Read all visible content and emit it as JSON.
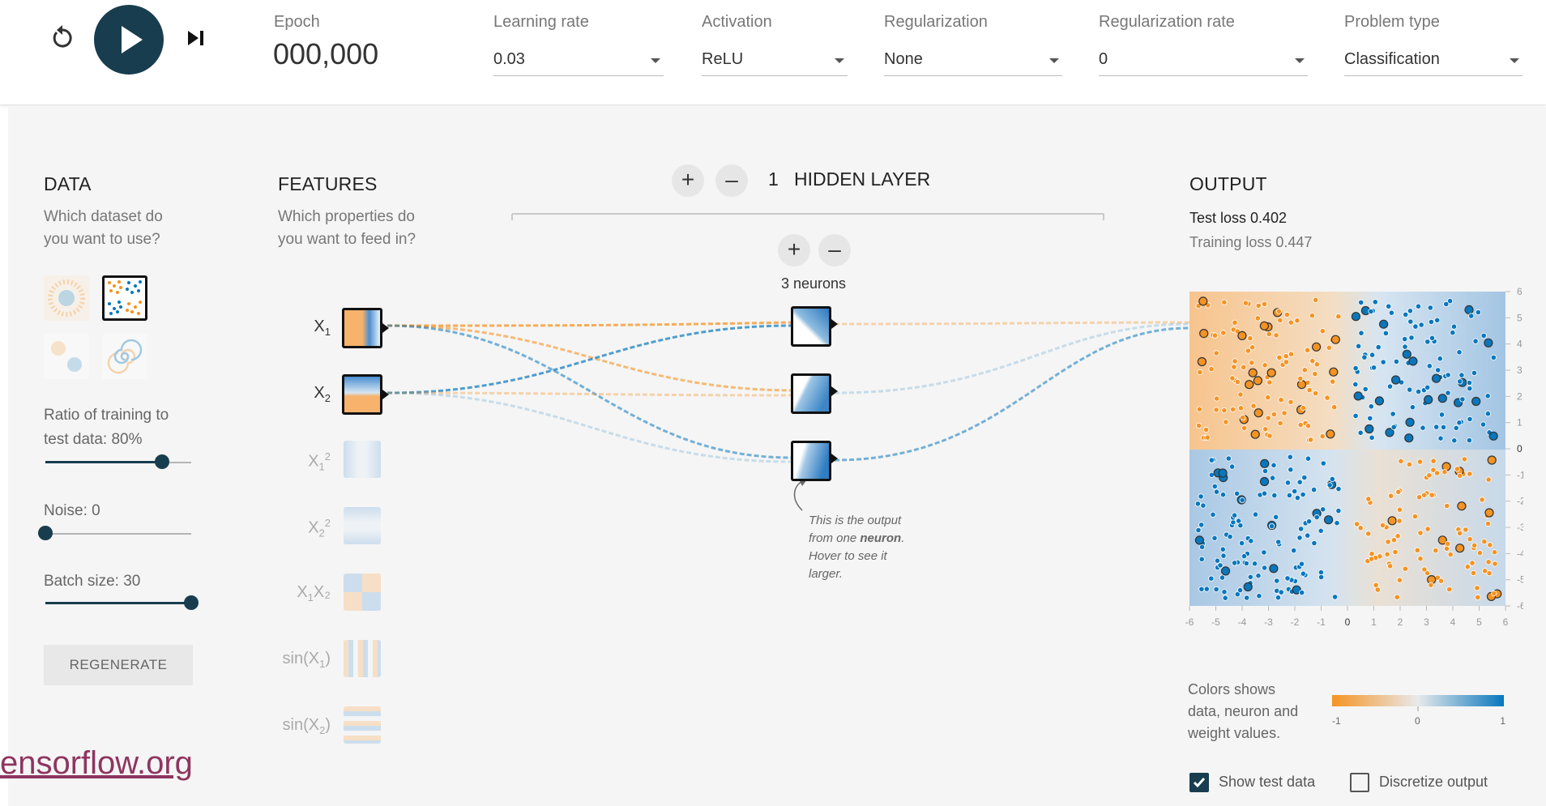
{
  "toolbar": {
    "epoch_label": "Epoch",
    "epoch_value": "000,000",
    "learning_rate_label": "Learning rate",
    "learning_rate_value": "0.03",
    "activation_label": "Activation",
    "activation_value": "ReLU",
    "regularization_label": "Regularization",
    "regularization_value": "None",
    "regularization_rate_label": "Regularization rate",
    "regularization_rate_value": "0",
    "problem_type_label": "Problem type",
    "problem_type_value": "Classification",
    "icons": [
      "reset-icon",
      "play-icon",
      "step-icon",
      "chevron-down-icon"
    ]
  },
  "data": {
    "title": "DATA",
    "subtitle_line1": "Which dataset do",
    "subtitle_line2": "you want to use?",
    "datasets": [
      "circle",
      "xor",
      "gaussian",
      "spiral"
    ],
    "selected_dataset": "xor",
    "ratio_label_line1": "Ratio of training to",
    "ratio_label_line2": "test data:  80%",
    "ratio_value": 0.8,
    "noise_label": "Noise:  0",
    "noise_value": 0,
    "batch_label": "Batch size:  30",
    "batch_value": 1.0,
    "regenerate_label": "REGENERATE"
  },
  "features": {
    "title": "FEATURES",
    "subtitle_line1": "Which properties do",
    "subtitle_line2": "you want to feed in?",
    "items": [
      {
        "base": "X",
        "sub": "1",
        "sup": "",
        "rest": "",
        "active": true
      },
      {
        "base": "X",
        "sub": "2",
        "sup": "",
        "rest": "",
        "active": true
      },
      {
        "base": "X",
        "sub": "1",
        "sup": "2",
        "rest": "",
        "active": false
      },
      {
        "base": "X",
        "sub": "2",
        "sup": "2",
        "rest": "",
        "active": false
      },
      {
        "base": "X",
        "sub": "1",
        "sup": "",
        "rest": "X₂",
        "active": false
      },
      {
        "base": "sin(X",
        "sub": "1",
        "sup": "",
        "rest": ")",
        "active": false
      },
      {
        "base": "sin(X",
        "sub": "2",
        "sup": "",
        "rest": ")",
        "active": false
      }
    ]
  },
  "network": {
    "layer_count": "1",
    "hidden_layer_label": "HIDDEN LAYER",
    "neuron_count_label": "3 neurons",
    "add_icon": "+",
    "remove_icon": "–",
    "callout_line1": "This is the output",
    "callout_line2_pre": "from one ",
    "callout_line2_bold": "neuron",
    "callout_line2_post": ".",
    "callout_line3": "Hover to see it",
    "callout_line4": "larger."
  },
  "output": {
    "title": "OUTPUT",
    "test_loss": "Test loss 0.402",
    "training_loss": "Training loss 0.447",
    "x_ticks": [
      "-6",
      "-5",
      "-4",
      "-3",
      "-2",
      "-1",
      "0",
      "1",
      "2",
      "3",
      "4",
      "5",
      "6"
    ],
    "y_ticks": [
      "6",
      "5",
      "4",
      "3",
      "2",
      "1",
      "0",
      "-1",
      "-2",
      "-3",
      "-4",
      "-5",
      "-6"
    ],
    "legend_line1": "Colors shows",
    "legend_line2": "data, neuron and",
    "legend_line3": "weight values.",
    "legend_ticks": [
      "-1",
      "0",
      "1"
    ],
    "show_test_label": "Show test data",
    "show_test_checked": true,
    "discretize_label": "Discretize output",
    "discretize_checked": false,
    "colors": {
      "orange": "#f59322",
      "blue": "#0877bd",
      "dark": "#183D4E"
    }
  },
  "watermark": "ensorflow.org"
}
